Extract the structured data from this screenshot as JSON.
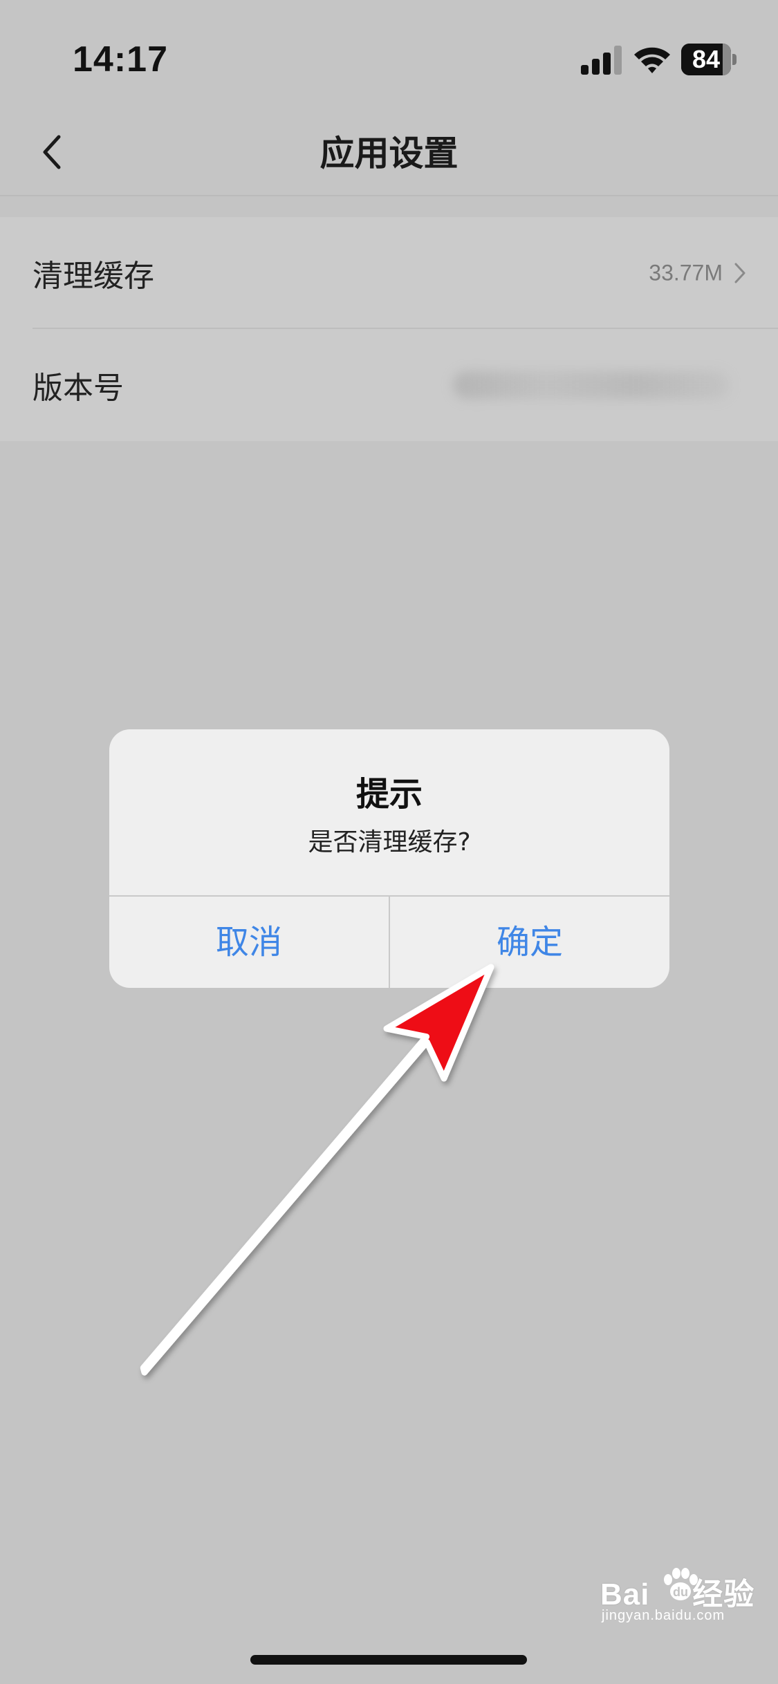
{
  "status_bar": {
    "time": "14:17",
    "battery_level": "84",
    "battery_fraction": 0.84,
    "signal_bars": 3,
    "signal_total": 4
  },
  "header": {
    "title": "应用设置"
  },
  "settings": {
    "rows": [
      {
        "label": "清理缓存",
        "value": "33.77M"
      },
      {
        "label": "版本号",
        "value": ""
      }
    ]
  },
  "dialog": {
    "title": "提示",
    "message": "是否清理缓存?",
    "cancel_label": "取消",
    "confirm_label": "确定"
  },
  "watermark": {
    "brand": "Bai",
    "brand_suffix": "经验",
    "url": "jingyan.baidu.com"
  },
  "colors": {
    "background": "#c4c4c4",
    "dialog_background": "#efefef",
    "dialog_button": "#3f86e6",
    "annotation_arrow": "#ee0a12"
  },
  "icons": [
    "back-icon",
    "signal-icon",
    "wifi-icon",
    "battery-icon",
    "chevron-right-icon",
    "annotation-arrow"
  ]
}
